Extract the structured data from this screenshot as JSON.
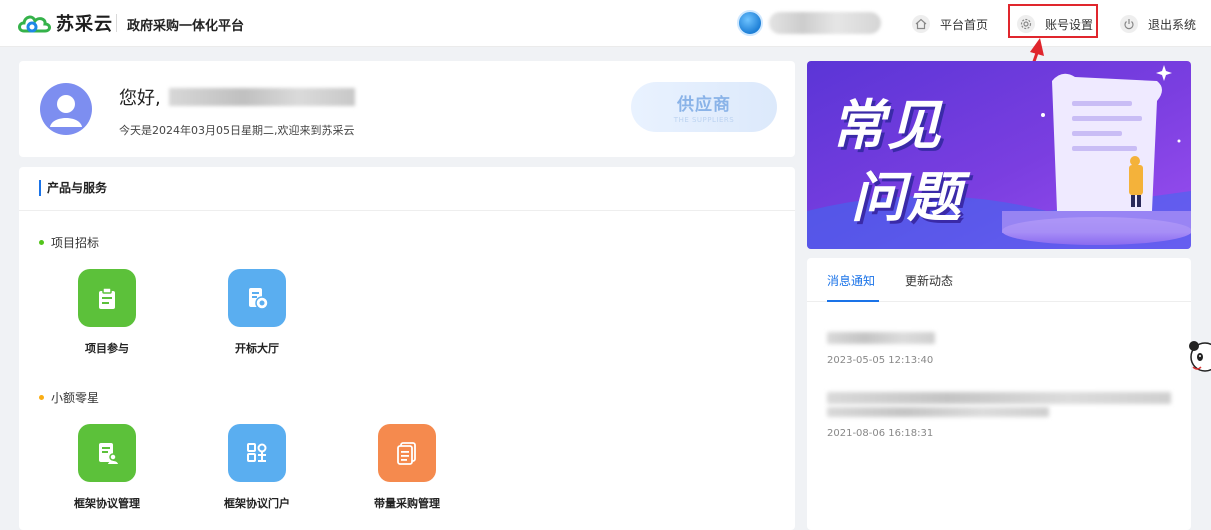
{
  "header": {
    "logo_text": "苏采云",
    "platform_name": "政府采购一体化平台",
    "nav": [
      {
        "label": "平台首页",
        "icon": "home-icon"
      },
      {
        "label": "账号设置",
        "icon": "gear-icon"
      },
      {
        "label": "退出系统",
        "icon": "power-icon"
      }
    ]
  },
  "welcome": {
    "greeting": "您好,",
    "date_line": "今天是2024年03月05日星期二,欢迎来到苏采云",
    "role_badge": {
      "cn": "供应商",
      "en": "THE SUPPLIERS"
    }
  },
  "products": {
    "title": "产品与服务",
    "sections": [
      {
        "label": "项目招标",
        "dot_color": "#52c41a",
        "tiles": [
          "项目参与",
          "开标大厅"
        ]
      },
      {
        "label": "小额零星",
        "dot_color": "#faad14",
        "tiles": [
          "框架协议管理",
          "框架协议门户",
          "带量采购管理"
        ]
      }
    ]
  },
  "banner": {
    "line1": "常见",
    "line2": "问题"
  },
  "notices": {
    "tabs": [
      "消息通知",
      "更新动态"
    ],
    "active_tab": 0,
    "items": [
      {
        "time": "2023-05-05 12:13:40"
      },
      {
        "time": "2021-08-06 16:18:31"
      }
    ]
  },
  "colors": {
    "accent": "#1a73e8",
    "highlight": "#e0262d",
    "tile_green": "#5cc13a",
    "tile_blue": "#5aaef0",
    "tile_orange": "#f58a4e",
    "avatar": "#7d8ef0"
  }
}
